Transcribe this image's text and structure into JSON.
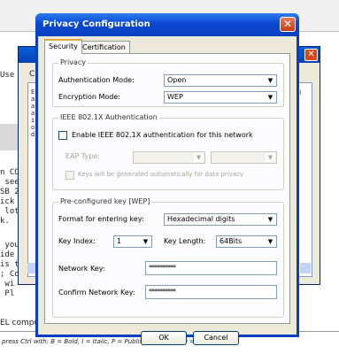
{
  "background": {
    "left_fragments": [
      "Use t",
      "n CO",
      " see",
      "SB 2",
      "ick",
      " lot",
      "k.",
      " you",
      "ide",
      "is t",
      "; Co",
      " wi",
      " Pl"
    ],
    "bottom_left": "EL compu",
    "shortcut_bar": "press Ctrl with: B = Bold, I = Italic, P = Publish, S = Save, D = Draft more",
    "bgwin_side_fragments": [
      "E",
      "ai",
      "ar",
      "ai",
      "in",
      "ol",
      "dk"
    ],
    "bgwin_right_letter": "el",
    "bgwin_tab_fragment": "C"
  },
  "dialog": {
    "title": "Privacy Configuration",
    "close_glyph": "✕",
    "tabs": [
      {
        "label": "Security",
        "active": true
      },
      {
        "label": "Certification",
        "active": false
      }
    ],
    "privacy": {
      "group_label": "Privacy",
      "auth_label": "Authentication Mode:",
      "auth_value": "Open",
      "enc_label": "Encryption Mode:",
      "enc_value": "WEP"
    },
    "ieee": {
      "group_label": "IEEE 802.1X Authentication",
      "enable_label": "Enable IEEE 802.1X authentication for this network",
      "eap_label": "EAP Type:",
      "eap_value": "",
      "eap_value2": "",
      "keys_label": "Keys will be generated automatically for data privacy"
    },
    "preconfig": {
      "group_label": "Pre-configured key [WEP]",
      "format_label": "Format for entering key:",
      "format_value": "Hexadecimal digits",
      "key_index_label": "Key Index:",
      "key_index_value": "1",
      "key_length_label": "Key Length:",
      "key_length_value": "64Bits",
      "network_key_label": "Network Key:",
      "network_key_value": "**********",
      "confirm_key_label": "Confirm Network Key:",
      "confirm_key_value": "**********"
    },
    "ok_label": "OK",
    "cancel_label": "Cancel"
  },
  "colors": {
    "title_bar": "#0a48d0",
    "dialog_face": "#ece9d8",
    "tab_highlight": "#e7a437"
  }
}
